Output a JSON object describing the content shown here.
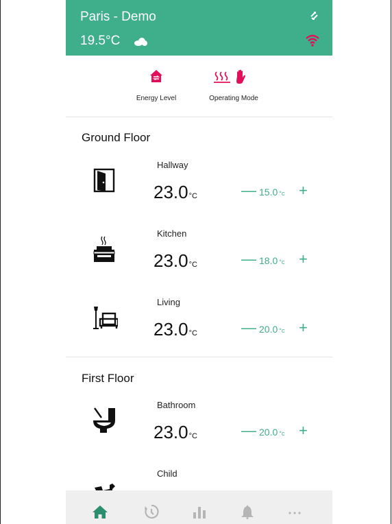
{
  "header": {
    "location": "Paris - Demo",
    "outside_temp": "19.5°C"
  },
  "modes": {
    "energy_level": "Energy Level",
    "operating_mode": "Operating Mode"
  },
  "floors": [
    {
      "name": "Ground Floor",
      "rooms": [
        {
          "name": "Hallway",
          "temp": "23.0",
          "setpoint": "15.0",
          "icon": "door-icon"
        },
        {
          "name": "Kitchen",
          "temp": "23.0",
          "setpoint": "18.0",
          "icon": "stove-icon"
        },
        {
          "name": "Living",
          "temp": "23.0",
          "setpoint": "20.0",
          "icon": "armchair-lamp-icon"
        }
      ]
    },
    {
      "name": "First Floor",
      "rooms": [
        {
          "name": "Bathroom",
          "temp": "23.0",
          "setpoint": "20.0",
          "icon": "toilet-icon"
        },
        {
          "name": "Child",
          "icon": "rocking-horse-icon"
        }
      ]
    }
  ],
  "units": {
    "temp": "°C",
    "setpoint": "°c"
  },
  "controls": {
    "minus": "—",
    "plus": "+"
  },
  "colors": {
    "accent": "#3fae8a",
    "alert": "#e0105a",
    "nav_active": "#2b8f6f",
    "nav_inactive": "#b5b5b5"
  },
  "nav": {
    "items": [
      "home-icon",
      "schedule-icon",
      "stats-icon",
      "bell-icon",
      "more-icon"
    ],
    "active": "home-icon"
  }
}
